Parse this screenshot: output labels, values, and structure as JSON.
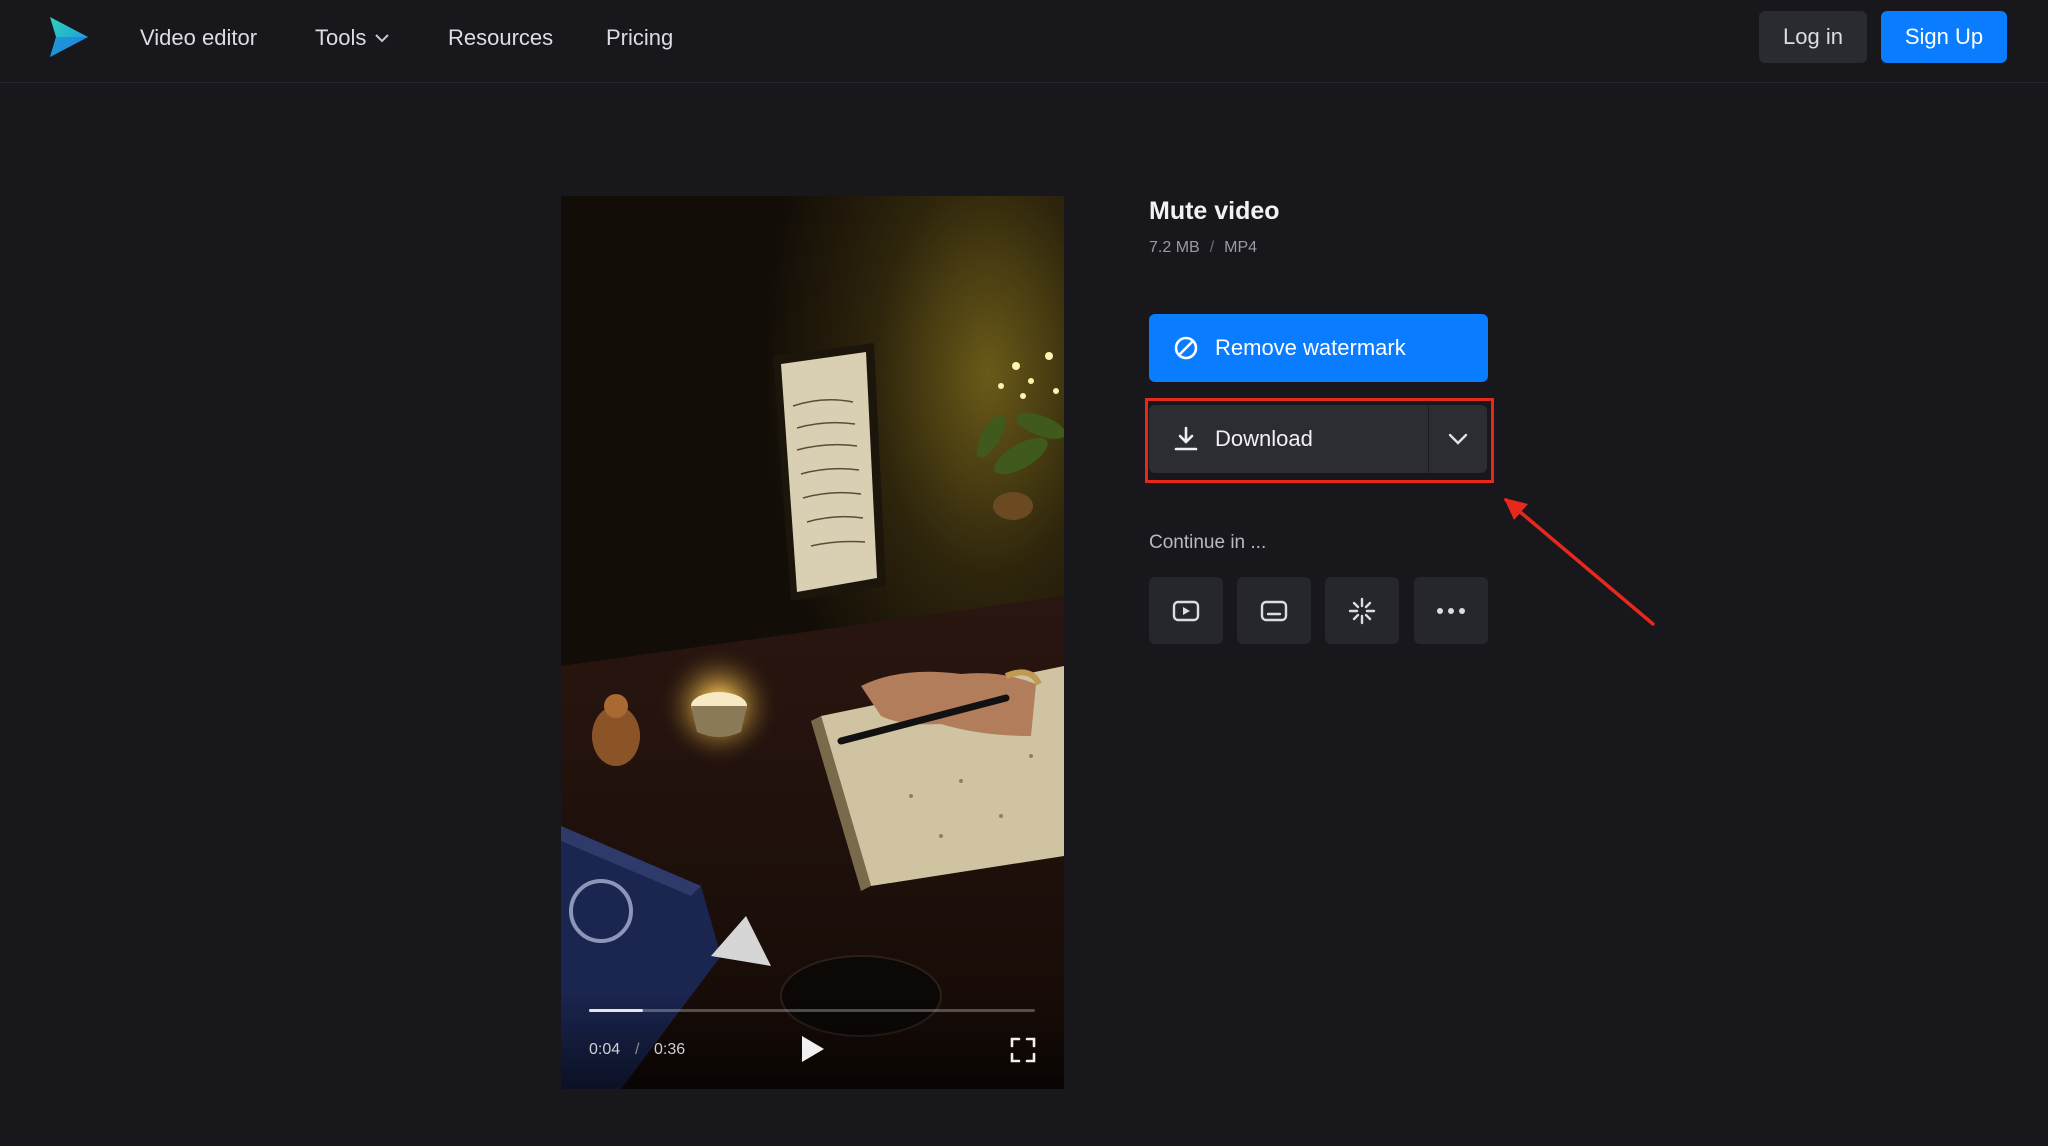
{
  "header": {
    "nav": [
      {
        "label": "Video editor"
      },
      {
        "label": "Tools"
      },
      {
        "label": "Resources"
      },
      {
        "label": "Pricing"
      }
    ],
    "login_label": "Log in",
    "signup_label": "Sign Up"
  },
  "player": {
    "current_time": "0:04",
    "separator": "/",
    "duration": "0:36",
    "progress": 0.12
  },
  "panel": {
    "title": "Mute video",
    "size": "7.2 MB",
    "meta_separator": "/",
    "format": "MP4",
    "remove_watermark_label": "Remove watermark",
    "download_label": "Download",
    "continue_label": "Continue in ..."
  },
  "colors": {
    "accent": "#0a7cff",
    "highlight": "#e8271d",
    "background": "#17171c"
  },
  "icons": {
    "logo": "play-logo",
    "tools_dropdown": "chevron-down-icon",
    "remove_watermark": "prohibit-icon",
    "download": "download-icon",
    "download_options": "chevron-down-icon",
    "continue_tools": [
      "video-play-icon",
      "subtitles-icon",
      "sparkle-icon",
      "more-icon"
    ],
    "player_play": "play-icon",
    "player_fullscreen": "fullscreen-icon"
  }
}
